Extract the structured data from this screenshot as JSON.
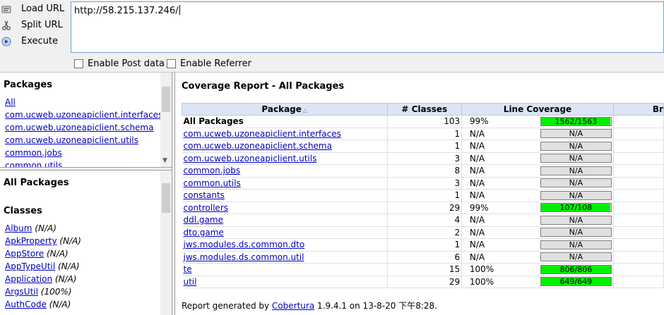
{
  "toolbar": {
    "load_url": "Load URL",
    "split_url": "Split URL",
    "execute": "Execute",
    "url_value": "http://58.215.137.246/",
    "enable_post": "Enable Post data",
    "enable_referrer": "Enable Referrer"
  },
  "packages_pane": {
    "title": "Packages",
    "items": [
      "All",
      "com.ucweb.uzoneapiclient.interfaces",
      "com.ucweb.uzoneapiclient.schema",
      "com.ucweb.uzoneapiclient.utils",
      "common.jobs",
      "common.utils"
    ]
  },
  "classes_pane": {
    "title": "All Packages",
    "subtitle": "Classes",
    "items": [
      {
        "name": "Album",
        "cov": "(N/A)"
      },
      {
        "name": "ApkProperty",
        "cov": "(N/A)"
      },
      {
        "name": "AppStore",
        "cov": "(N/A)"
      },
      {
        "name": "AppTypeUtil",
        "cov": "(N/A)"
      },
      {
        "name": "Application",
        "cov": "(N/A)"
      },
      {
        "name": "ArgsUtil",
        "cov": "(100%)"
      },
      {
        "name": "AuthCode",
        "cov": "(N/A)"
      }
    ]
  },
  "report": {
    "title": "Coverage Report - All Packages",
    "headers": {
      "package": "Package",
      "classes": "# Classes",
      "line": "Line Coverage",
      "branch": "Br"
    },
    "rows": [
      {
        "pkg": "All Packages",
        "classes": "103",
        "pct": "99%",
        "bar": "1562/1563",
        "fill": 0.99,
        "link": false
      },
      {
        "pkg": "com.ucweb.uzoneapiclient.interfaces",
        "classes": "1",
        "pct": "N/A",
        "bar": "N/A",
        "fill": 0,
        "link": true
      },
      {
        "pkg": "com.ucweb.uzoneapiclient.schema",
        "classes": "1",
        "pct": "N/A",
        "bar": "N/A",
        "fill": 0,
        "link": true
      },
      {
        "pkg": "com.ucweb.uzoneapiclient.utils",
        "classes": "3",
        "pct": "N/A",
        "bar": "N/A",
        "fill": 0,
        "link": true
      },
      {
        "pkg": "common.jobs",
        "classes": "8",
        "pct": "N/A",
        "bar": "N/A",
        "fill": 0,
        "link": true
      },
      {
        "pkg": "common.utils",
        "classes": "3",
        "pct": "N/A",
        "bar": "N/A",
        "fill": 0,
        "link": true
      },
      {
        "pkg": "constants",
        "classes": "1",
        "pct": "N/A",
        "bar": "N/A",
        "fill": 0,
        "link": true
      },
      {
        "pkg": "controllers",
        "classes": "29",
        "pct": "99%",
        "bar": "107/108",
        "fill": 0.99,
        "link": true
      },
      {
        "pkg": "ddl.game",
        "classes": "4",
        "pct": "N/A",
        "bar": "N/A",
        "fill": 0,
        "link": true
      },
      {
        "pkg": "dto.game",
        "classes": "2",
        "pct": "N/A",
        "bar": "N/A",
        "fill": 0,
        "link": true
      },
      {
        "pkg": "jws.modules.ds.common.dto",
        "classes": "1",
        "pct": "N/A",
        "bar": "N/A",
        "fill": 0,
        "link": true
      },
      {
        "pkg": "jws.modules.ds.common.util",
        "classes": "6",
        "pct": "N/A",
        "bar": "N/A",
        "fill": 0,
        "link": true
      },
      {
        "pkg": "te",
        "classes": "15",
        "pct": "100%",
        "bar": "806/806",
        "fill": 1,
        "link": true
      },
      {
        "pkg": "util",
        "classes": "29",
        "pct": "100%",
        "bar": "649/649",
        "fill": 1,
        "link": true
      }
    ],
    "footer_prefix": "Report generated by ",
    "footer_link": "Cobertura",
    "footer_suffix": " 1.9.4.1 on 13-8-20 下午8:28."
  },
  "colors": {
    "bar_fill": "#00ee00",
    "link": "#0000c0",
    "header_bg": "#dce5f5"
  }
}
